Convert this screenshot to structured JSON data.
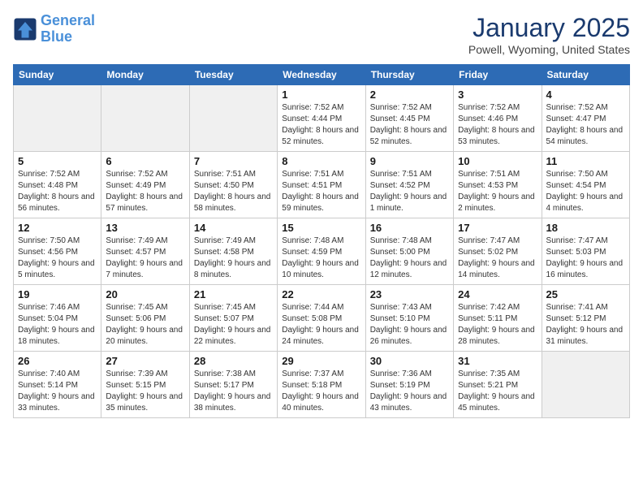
{
  "header": {
    "logo_line1": "General",
    "logo_line2": "Blue",
    "title": "January 2025",
    "subtitle": "Powell, Wyoming, United States"
  },
  "weekdays": [
    "Sunday",
    "Monday",
    "Tuesday",
    "Wednesday",
    "Thursday",
    "Friday",
    "Saturday"
  ],
  "weeks": [
    [
      {
        "day": "",
        "empty": true
      },
      {
        "day": "",
        "empty": true
      },
      {
        "day": "",
        "empty": true
      },
      {
        "day": "1",
        "info": "Sunrise: 7:52 AM\nSunset: 4:44 PM\nDaylight: 8 hours and 52 minutes."
      },
      {
        "day": "2",
        "info": "Sunrise: 7:52 AM\nSunset: 4:45 PM\nDaylight: 8 hours and 52 minutes."
      },
      {
        "day": "3",
        "info": "Sunrise: 7:52 AM\nSunset: 4:46 PM\nDaylight: 8 hours and 53 minutes."
      },
      {
        "day": "4",
        "info": "Sunrise: 7:52 AM\nSunset: 4:47 PM\nDaylight: 8 hours and 54 minutes."
      }
    ],
    [
      {
        "day": "5",
        "info": "Sunrise: 7:52 AM\nSunset: 4:48 PM\nDaylight: 8 hours and 56 minutes."
      },
      {
        "day": "6",
        "info": "Sunrise: 7:52 AM\nSunset: 4:49 PM\nDaylight: 8 hours and 57 minutes."
      },
      {
        "day": "7",
        "info": "Sunrise: 7:51 AM\nSunset: 4:50 PM\nDaylight: 8 hours and 58 minutes."
      },
      {
        "day": "8",
        "info": "Sunrise: 7:51 AM\nSunset: 4:51 PM\nDaylight: 8 hours and 59 minutes."
      },
      {
        "day": "9",
        "info": "Sunrise: 7:51 AM\nSunset: 4:52 PM\nDaylight: 9 hours and 1 minute."
      },
      {
        "day": "10",
        "info": "Sunrise: 7:51 AM\nSunset: 4:53 PM\nDaylight: 9 hours and 2 minutes."
      },
      {
        "day": "11",
        "info": "Sunrise: 7:50 AM\nSunset: 4:54 PM\nDaylight: 9 hours and 4 minutes."
      }
    ],
    [
      {
        "day": "12",
        "info": "Sunrise: 7:50 AM\nSunset: 4:56 PM\nDaylight: 9 hours and 5 minutes."
      },
      {
        "day": "13",
        "info": "Sunrise: 7:49 AM\nSunset: 4:57 PM\nDaylight: 9 hours and 7 minutes."
      },
      {
        "day": "14",
        "info": "Sunrise: 7:49 AM\nSunset: 4:58 PM\nDaylight: 9 hours and 8 minutes."
      },
      {
        "day": "15",
        "info": "Sunrise: 7:48 AM\nSunset: 4:59 PM\nDaylight: 9 hours and 10 minutes."
      },
      {
        "day": "16",
        "info": "Sunrise: 7:48 AM\nSunset: 5:00 PM\nDaylight: 9 hours and 12 minutes."
      },
      {
        "day": "17",
        "info": "Sunrise: 7:47 AM\nSunset: 5:02 PM\nDaylight: 9 hours and 14 minutes."
      },
      {
        "day": "18",
        "info": "Sunrise: 7:47 AM\nSunset: 5:03 PM\nDaylight: 9 hours and 16 minutes."
      }
    ],
    [
      {
        "day": "19",
        "info": "Sunrise: 7:46 AM\nSunset: 5:04 PM\nDaylight: 9 hours and 18 minutes."
      },
      {
        "day": "20",
        "info": "Sunrise: 7:45 AM\nSunset: 5:06 PM\nDaylight: 9 hours and 20 minutes."
      },
      {
        "day": "21",
        "info": "Sunrise: 7:45 AM\nSunset: 5:07 PM\nDaylight: 9 hours and 22 minutes."
      },
      {
        "day": "22",
        "info": "Sunrise: 7:44 AM\nSunset: 5:08 PM\nDaylight: 9 hours and 24 minutes."
      },
      {
        "day": "23",
        "info": "Sunrise: 7:43 AM\nSunset: 5:10 PM\nDaylight: 9 hours and 26 minutes."
      },
      {
        "day": "24",
        "info": "Sunrise: 7:42 AM\nSunset: 5:11 PM\nDaylight: 9 hours and 28 minutes."
      },
      {
        "day": "25",
        "info": "Sunrise: 7:41 AM\nSunset: 5:12 PM\nDaylight: 9 hours and 31 minutes."
      }
    ],
    [
      {
        "day": "26",
        "info": "Sunrise: 7:40 AM\nSunset: 5:14 PM\nDaylight: 9 hours and 33 minutes."
      },
      {
        "day": "27",
        "info": "Sunrise: 7:39 AM\nSunset: 5:15 PM\nDaylight: 9 hours and 35 minutes."
      },
      {
        "day": "28",
        "info": "Sunrise: 7:38 AM\nSunset: 5:17 PM\nDaylight: 9 hours and 38 minutes."
      },
      {
        "day": "29",
        "info": "Sunrise: 7:37 AM\nSunset: 5:18 PM\nDaylight: 9 hours and 40 minutes."
      },
      {
        "day": "30",
        "info": "Sunrise: 7:36 AM\nSunset: 5:19 PM\nDaylight: 9 hours and 43 minutes."
      },
      {
        "day": "31",
        "info": "Sunrise: 7:35 AM\nSunset: 5:21 PM\nDaylight: 9 hours and 45 minutes."
      },
      {
        "day": "",
        "empty": true
      }
    ]
  ]
}
